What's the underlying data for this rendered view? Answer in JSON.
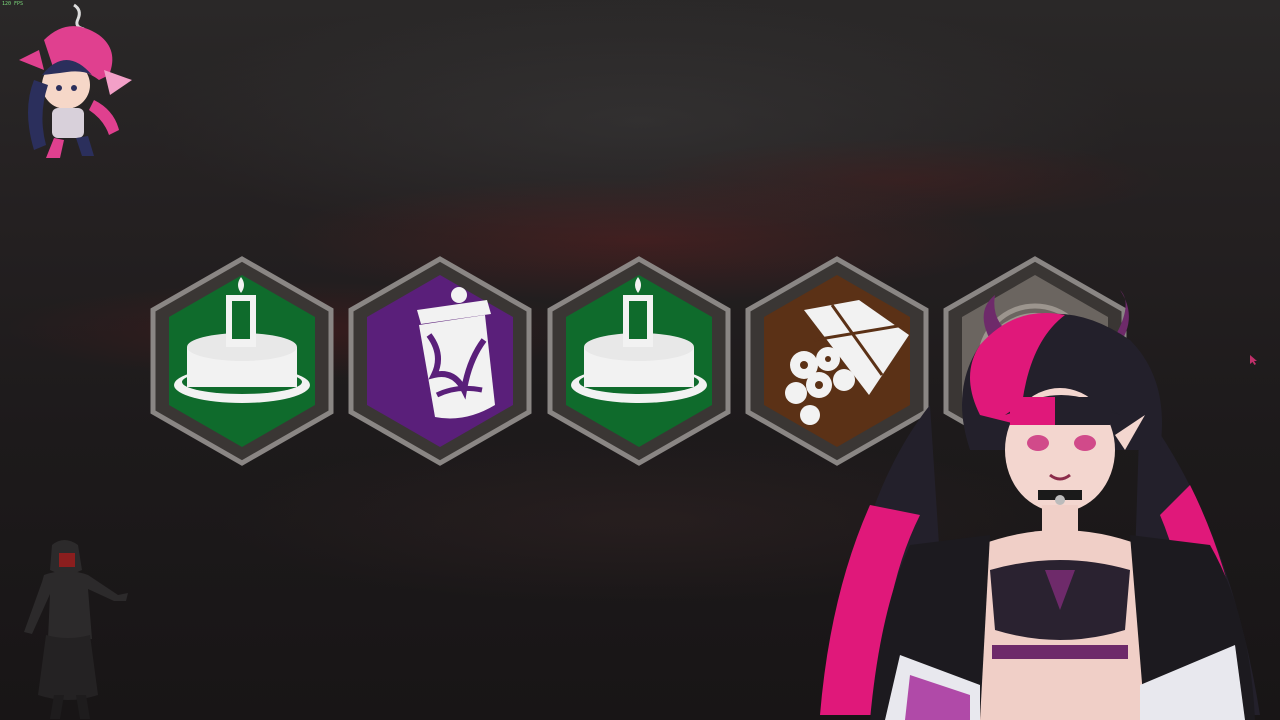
{
  "overlay": {
    "fps_text": "120 FPS"
  },
  "perks": [
    {
      "icon": "birthday-cake-icon",
      "background": "#0f6b2c"
    },
    {
      "icon": "jar-icon",
      "background": "#5a1f7a"
    },
    {
      "icon": "birthday-cake-icon",
      "background": "#0f6b2c"
    },
    {
      "icon": "flower-wrapped-gift-icon",
      "background": "#5b3116"
    },
    {
      "icon": "locked-perk-icon",
      "background": "#6b6560"
    }
  ],
  "colors": {
    "perk_frame": "#8a8684",
    "accent_red": "#8b1e1e",
    "vtuber_pink": "#e0187a"
  }
}
